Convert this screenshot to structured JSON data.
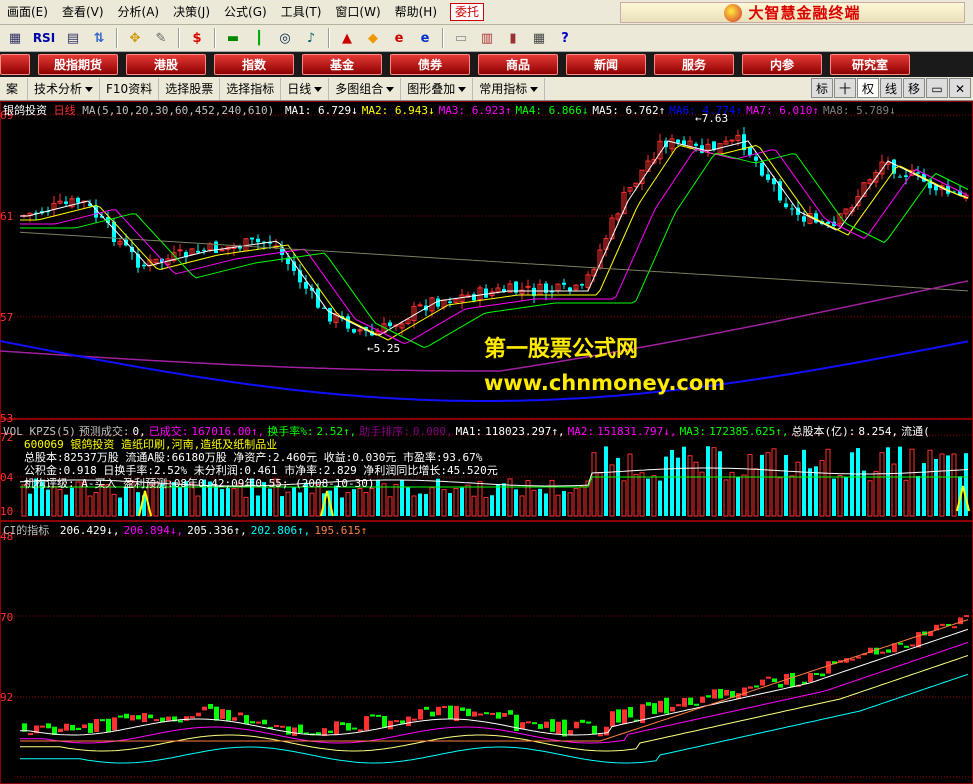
{
  "menubar": {
    "items": [
      "画面(E)",
      "查看(V)",
      "分析(A)",
      "决策(J)",
      "公式(G)",
      "工具(T)",
      "窗口(W)",
      "帮助(H)"
    ],
    "highlight": "委托",
    "brand": "大智慧金融终端"
  },
  "toolbar": {
    "icons": [
      "grid-icon",
      "rsi-icon",
      "table-icon",
      "arrows-icon",
      "move-icon",
      "ruler-icon",
      "dollar-icon",
      "flag-icon",
      "bars-icon",
      "binoculars-icon",
      "bell-icon",
      "up-icon",
      "diamond-icon",
      "ie-icon",
      "ie2-icon",
      "note-icon",
      "table2-icon",
      "books-icon",
      "grid2-icon",
      "help-icon"
    ],
    "rsi_label": "RSI"
  },
  "navbar": {
    "items": [
      "股指期货",
      "港股",
      "指数",
      "基金",
      "债券",
      "商品",
      "新闻",
      "服务",
      "内参",
      "研究室"
    ]
  },
  "subbar": {
    "left_label": "案",
    "items": [
      "技术分析",
      "F10资料",
      "选择股票",
      "选择指标",
      "日线",
      "多图组合",
      "图形叠加",
      "常用指标"
    ],
    "right_buttons": [
      "标",
      "十",
      "权",
      "线",
      "移"
    ]
  },
  "main_panel": {
    "stock_name": "银鸽投资",
    "period": "日线",
    "ma_params": "MA(5,10,20,30,60,452,240,610)",
    "ma": [
      {
        "label": "MA1:",
        "value": "6.729",
        "dir": "↓",
        "color": "#ffffff"
      },
      {
        "label": "MA2:",
        "value": "6.943",
        "dir": "↓",
        "color": "#ffff00"
      },
      {
        "label": "MA3:",
        "value": "6.923",
        "dir": "↑",
        "color": "#ff00ff"
      },
      {
        "label": "MA4:",
        "value": "6.866",
        "dir": "↓",
        "color": "#00ff00"
      },
      {
        "label": "MA5:",
        "value": "6.762",
        "dir": "↑",
        "color": "#ffffff"
      },
      {
        "label": "MA6:",
        "value": "4.774",
        "dir": "↑",
        "color": "#0000ff"
      },
      {
        "label": "MA7:",
        "value": "6.010",
        "dir": "↑",
        "color": "#ff00ff"
      },
      {
        "label": "MA8:",
        "value": "5.789",
        "dir": "↓",
        "color": "#808080"
      }
    ],
    "high_label": "7.63",
    "low_label": "5.25",
    "y_ticks": [
      "69",
      "61",
      "57",
      "53"
    ]
  },
  "watermark": {
    "line1": "第一股票公式网",
    "line2": "www.chnmoney.com"
  },
  "volume_panel": {
    "header": [
      {
        "text": "VOL KPZS(5)",
        "color": "#c0c0c0"
      },
      {
        "text": "预测成交:",
        "color": "#c0c0c0"
      },
      {
        "text": "0,",
        "color": "#ffffff"
      },
      {
        "text": "已成交:",
        "color": "#ff00ff"
      },
      {
        "text": "167016.00↑,",
        "color": "#ff00ff"
      },
      {
        "text": "换手率%:",
        "color": "#00ff00"
      },
      {
        "text": "2.52↑,",
        "color": "#00ff00"
      },
      {
        "text": "助手排序:",
        "color": "#800080"
      },
      {
        "text": "0.000,",
        "color": "#800080"
      },
      {
        "text": "MA1:",
        "color": "#ffffff"
      },
      {
        "text": "118023.297↑,",
        "color": "#ffffff"
      },
      {
        "text": "MA2:",
        "color": "#ff00ff"
      },
      {
        "text": "151831.797↓,",
        "color": "#ff00ff"
      },
      {
        "text": "MA3:",
        "color": "#00ff00"
      },
      {
        "text": "172385.625↑,",
        "color": "#00ff00"
      },
      {
        "text": "总股本(亿):",
        "color": "#ffffff"
      },
      {
        "text": "8.254,",
        "color": "#ffffff"
      },
      {
        "text": "流通(",
        "color": "#ffffff"
      }
    ],
    "y_ticks": [
      "72",
      "04",
      "10"
    ],
    "f10": {
      "line1_code": "600069",
      "line1_name": "银鸽投资",
      "line1_industry": "造纸印刷,河南,造纸及纸制品业",
      "line2": "总股本:82537万股  流通A股:66180万股  净资产:2.460元  收益:0.030元  市盈率:93.67%",
      "line3": "公积金:0.918  日换手率:2.52%  未分利润:0.461  市净率:2.829  净利润同比增长:45.520元",
      "line4": "机构评级: A-买入  盈利预测:08年0.42;09年0.55;  (2008-10-30)"
    }
  },
  "ci_panel": {
    "title": "CI的指标",
    "values": [
      {
        "text": "206.429↓,",
        "color": "#ffffff"
      },
      {
        "text": "206.894↓,",
        "color": "#ff00ff"
      },
      {
        "text": "205.336↑,",
        "color": "#ffffff"
      },
      {
        "text": "202.806↑,",
        "color": "#00ffff"
      },
      {
        "text": "195.615↑",
        "color": "#ff8040"
      }
    ],
    "y_ticks": [
      "48",
      "70",
      "92"
    ]
  },
  "colors": {
    "up": "#ff3030",
    "down": "#00ffff",
    "grid": "#8b0000"
  }
}
